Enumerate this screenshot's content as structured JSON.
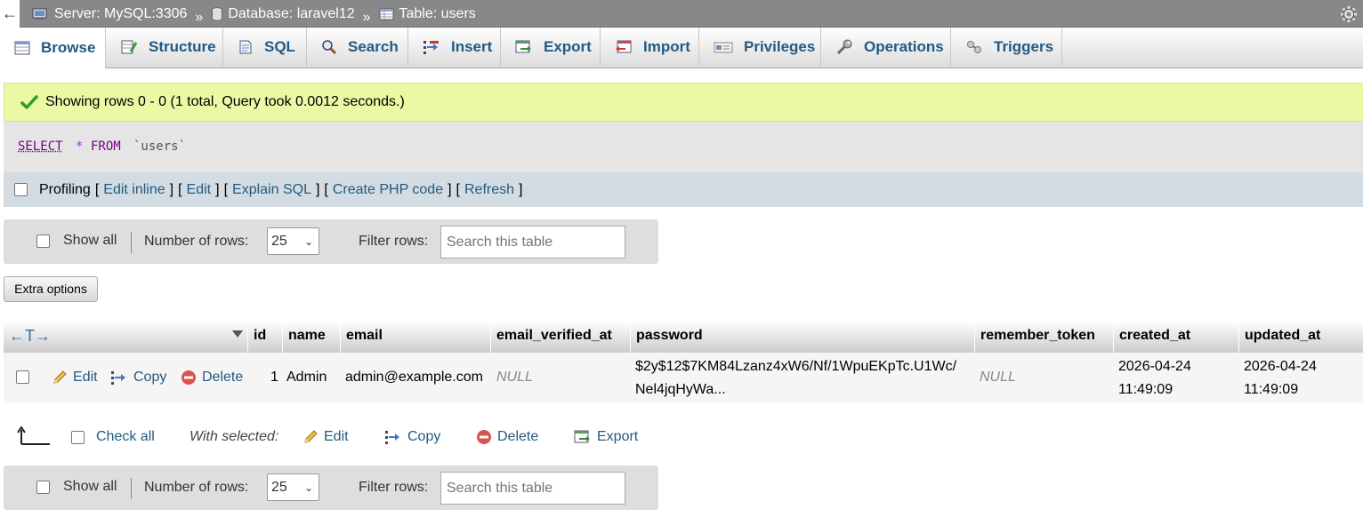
{
  "breadcrumb": {
    "back": "←",
    "server": "Server: MySQL:3306",
    "database": "Database: laravel12",
    "table": "Table: users",
    "separator": "»"
  },
  "tabs": [
    {
      "label": "Browse",
      "icon": "browse-icon",
      "active": true
    },
    {
      "label": "Structure",
      "icon": "structure-icon"
    },
    {
      "label": "SQL",
      "icon": "sql-icon"
    },
    {
      "label": "Search",
      "icon": "search-icon"
    },
    {
      "label": "Insert",
      "icon": "insert-icon"
    },
    {
      "label": "Export",
      "icon": "export-icon"
    },
    {
      "label": "Import",
      "icon": "import-icon"
    },
    {
      "label": "Privileges",
      "icon": "privileges-icon"
    },
    {
      "label": "Operations",
      "icon": "operations-icon"
    },
    {
      "label": "Triggers",
      "icon": "triggers-icon"
    }
  ],
  "success_message": "Showing rows 0 - 0 (1 total, Query took 0.0012 seconds.)",
  "sql": {
    "select": "SELECT",
    "star": "*",
    "from": "FROM",
    "table": "`users`"
  },
  "links": {
    "profiling": "Profiling",
    "open": "[",
    "close": "]",
    "edit_inline": "Edit inline",
    "edit": "Edit",
    "explain_sql": "Explain SQL",
    "create_php": "Create PHP code",
    "refresh": "Refresh"
  },
  "nav": {
    "show_all": "Show all",
    "number_of_rows_label": "Number of rows:",
    "rows_value": "25",
    "filter_label": "Filter rows:",
    "filter_placeholder": "Search this table"
  },
  "extra_options": "Extra options",
  "table": {
    "arrows": "←T→",
    "columns": [
      "id",
      "name",
      "email",
      "email_verified_at",
      "password",
      "remember_token",
      "created_at",
      "updated_at"
    ],
    "rows": [
      {
        "actions": {
          "edit": "Edit",
          "copy": "Copy",
          "delete": "Delete"
        },
        "id": "1",
        "name": "Admin",
        "email": "admin@example.com",
        "email_verified_at": "NULL",
        "password_line1": "$2y$12$7KM84Lzanz4xW6/Nf/1WpuEKpTc.U1Wc/",
        "password_line2": "Nel4jqHyWa...",
        "remember_token": "NULL",
        "created_at_date": "2026-04-24",
        "created_at_time": "11:49:09",
        "updated_at_date": "2026-04-24",
        "updated_at_time": "11:49:09"
      }
    ]
  },
  "bulk": {
    "check_all": "Check all",
    "with_selected": "With selected:",
    "edit": "Edit",
    "copy": "Copy",
    "delete": "Delete",
    "export": "Export"
  },
  "colors": {
    "link": "#235a81",
    "success_bg": "#ebf8a4",
    "breadcrumb_bg": "#888888"
  }
}
